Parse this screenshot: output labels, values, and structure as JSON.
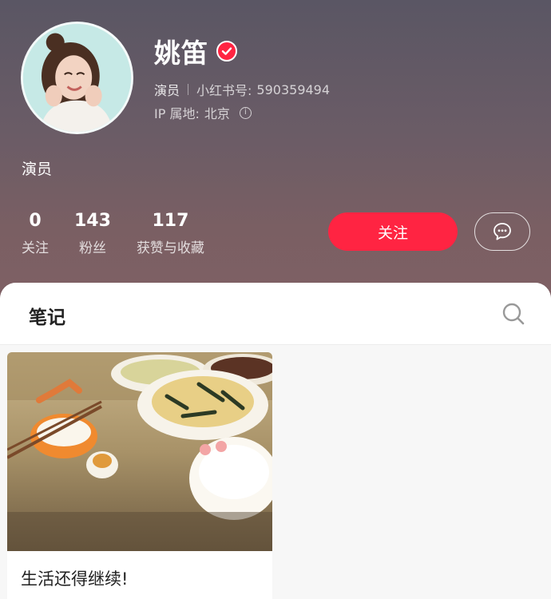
{
  "profile": {
    "name": "姚笛",
    "role": "演员",
    "red_id_label": "小红书号:",
    "red_id": "590359494",
    "ip_label": "IP 属地:",
    "ip_location": "北京",
    "bio": "演员"
  },
  "stats": [
    {
      "value": "0",
      "label": "关注"
    },
    {
      "value": "143",
      "label": "粉丝"
    },
    {
      "value": "117",
      "label": "获赞与收藏"
    }
  ],
  "actions": {
    "follow_label": "关注",
    "message_icon": "message-bubble-icon"
  },
  "tabs": {
    "notes_label": "笔记",
    "search_icon": "search-icon"
  },
  "notes": [
    {
      "title": "生活还得继续!"
    }
  ],
  "colors": {
    "accent": "#ff2442"
  }
}
